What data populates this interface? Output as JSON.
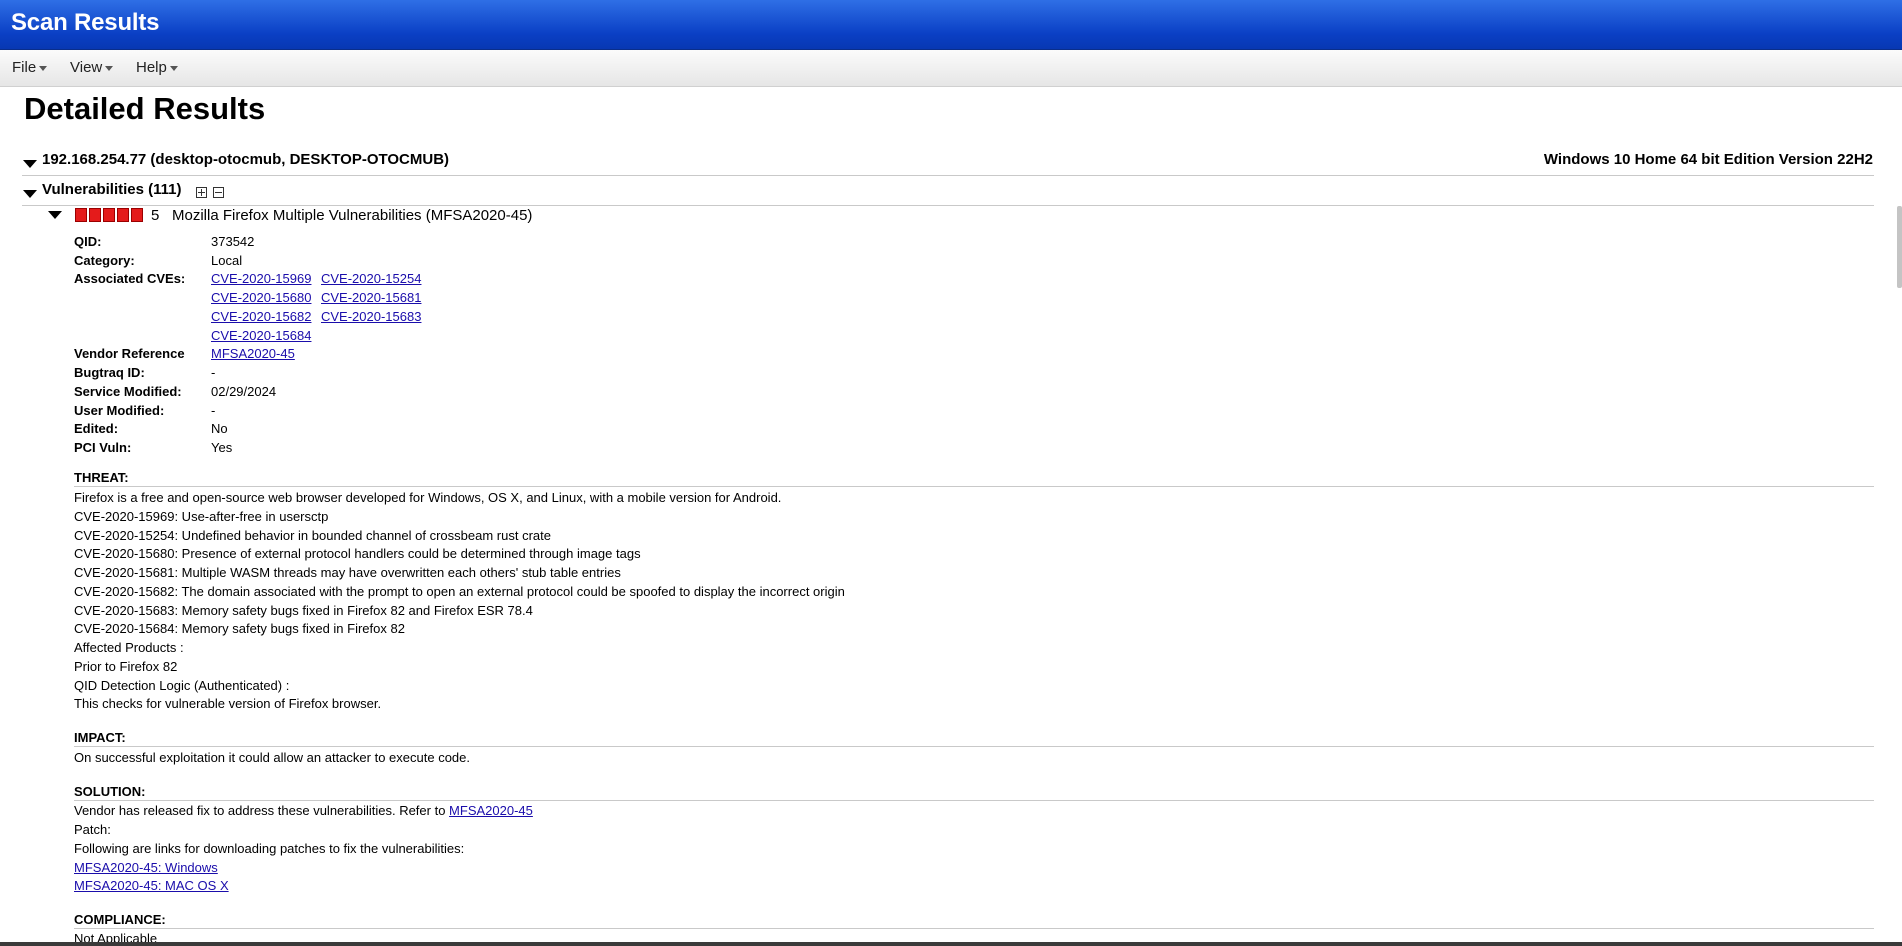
{
  "app": {
    "title": "Scan Results"
  },
  "menu": [
    {
      "label": "File"
    },
    {
      "label": "View"
    },
    {
      "label": "Help"
    }
  ],
  "page": {
    "title": "Detailed Results"
  },
  "host": {
    "label": "192.168.254.77 (desktop-otocmub, DESKTOP-OTOCMUB)",
    "os": "Windows 10 Home 64 bit Edition Version 22H2"
  },
  "vulns": {
    "label": "Vulnerabilities (111)"
  },
  "vuln": {
    "severity": "5",
    "title": "Mozilla Firefox Multiple Vulnerabilities (MFSA2020-45)",
    "severity_color": "#e41b1b",
    "fields": {
      "qid_label": "QID:",
      "qid": "373542",
      "category_label": "Category:",
      "category": "Local",
      "cves_label": "Associated CVEs:",
      "cves": [
        "CVE-2020-15969",
        "CVE-2020-15254",
        "CVE-2020-15680",
        "CVE-2020-15681",
        "CVE-2020-15682",
        "CVE-2020-15683",
        "CVE-2020-15684"
      ],
      "vendor_label": "Vendor Reference",
      "vendor": "MFSA2020-45",
      "bugtraq_label": "Bugtraq ID:",
      "bugtraq": "-",
      "service_label": "Service Modified:",
      "service": "02/29/2024",
      "user_label": "User Modified:",
      "user": "-",
      "edited_label": "Edited:",
      "edited": "No",
      "pci_label": "PCI Vuln:",
      "pci": "Yes"
    },
    "threat": {
      "heading": "THREAT:",
      "lines": [
        "Firefox is a free and open-source web browser developed for Windows, OS X, and Linux, with a mobile version for Android.",
        "CVE-2020-15969: Use-after-free in usersctp",
        "CVE-2020-15254: Undefined behavior in bounded channel of crossbeam rust crate",
        "CVE-2020-15680: Presence of external protocol handlers could be determined through image tags",
        "CVE-2020-15681: Multiple WASM threads may have overwritten each others' stub table entries",
        "CVE-2020-15682: The domain associated with the prompt to open an external protocol could be spoofed to display the incorrect origin",
        "CVE-2020-15683: Memory safety bugs fixed in Firefox 82 and Firefox ESR 78.4",
        "CVE-2020-15684: Memory safety bugs fixed in Firefox 82",
        "Affected Products :",
        "Prior to Firefox 82",
        "QID Detection Logic (Authenticated) :",
        "This checks for vulnerable version of Firefox browser."
      ]
    },
    "impact": {
      "heading": "IMPACT:",
      "text": "On successful exploitation it could allow an attacker to execute code."
    },
    "solution": {
      "heading": "SOLUTION:",
      "intro": "Vendor has released fix to address these vulnerabilities. Refer to ",
      "intro_link": "MFSA2020-45",
      "patch": "Patch:",
      "following": "Following are links for downloading patches to fix the vulnerabilities:",
      "link_windows": "MFSA2020-45: Windows",
      "link_mac": "MFSA2020-45: MAC OS X"
    },
    "compliance": {
      "heading": "COMPLIANCE:",
      "text": "Not Applicable"
    }
  }
}
